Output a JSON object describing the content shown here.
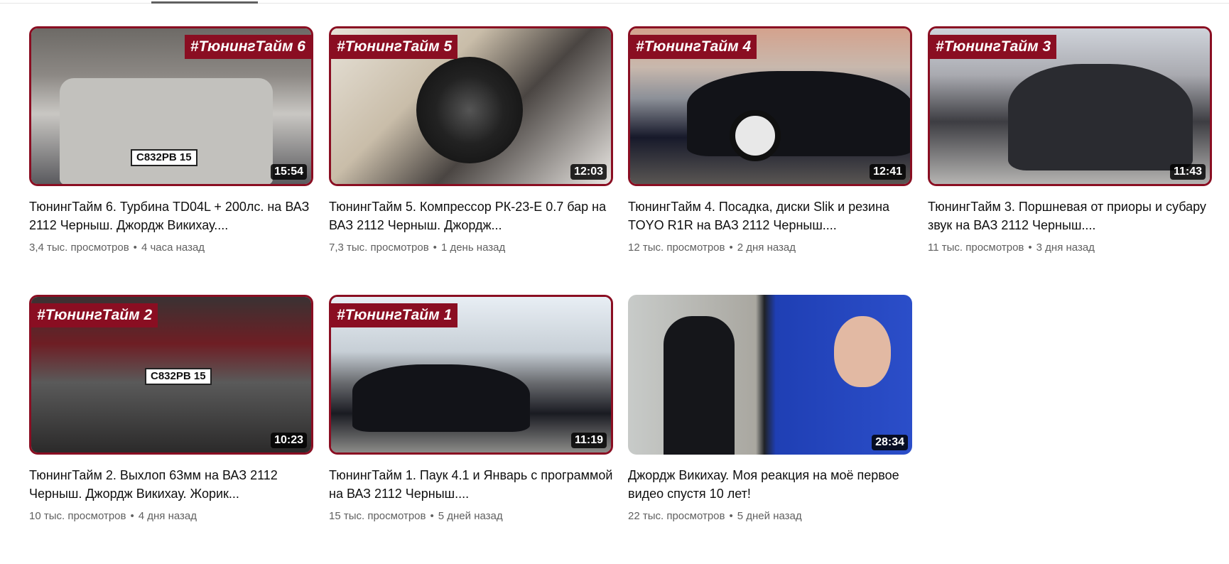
{
  "videos": [
    {
      "tag": "#ТюнингТайм 6",
      "duration": "15:54",
      "title": "ТюнингТайм 6. Турбина TD04L + 200лс. на ВАЗ 2112 Черныш. Джордж Викихау....",
      "views": "3,4 тыс. просмотров",
      "age": "4 часа назад",
      "plate": "С832РВ 15"
    },
    {
      "tag": "#ТюнингТайм 5",
      "duration": "12:03",
      "title": "ТюнингТайм 5. Компрессор РК-23-Е 0.7 бар на ВАЗ 2112 Черныш. Джордж...",
      "views": "7,3 тыс. просмотров",
      "age": "1 день назад"
    },
    {
      "tag": "#ТюнингТайм 4",
      "duration": "12:41",
      "title": "ТюнингТайм 4. Посадка, диски Slik и резина TOYO R1R на ВАЗ 2112 Черныш....",
      "views": "12 тыс. просмотров",
      "age": "2 дня назад"
    },
    {
      "tag": "#ТюнингТайм 3",
      "duration": "11:43",
      "title": "ТюнингТайм 3. Поршневая от приоры и субару звук на ВАЗ 2112 Черныш....",
      "views": "11 тыс. просмотров",
      "age": "3 дня назад"
    },
    {
      "tag": "#ТюнингТайм 2",
      "duration": "10:23",
      "title": "ТюнингТайм 2. Выхлоп 63мм на ВАЗ 2112 Черныш. Джордж Викихау. Жорик...",
      "views": "10 тыс. просмотров",
      "age": "4 дня назад",
      "plate": "С832РВ 15"
    },
    {
      "tag": "#ТюнингТайм 1",
      "duration": "11:19",
      "title": "ТюнингТайм 1. Паук 4.1 и Январь с программой на ВАЗ 2112 Черныш....",
      "views": "15 тыс. просмотров",
      "age": "5 дней назад"
    },
    {
      "duration": "28:34",
      "title": "Джордж Викихау. Моя реакция на моё первое видео спустя 10 лет!",
      "views": "22 тыс. просмотров",
      "age": "5 дней назад"
    }
  ],
  "separator": "•"
}
